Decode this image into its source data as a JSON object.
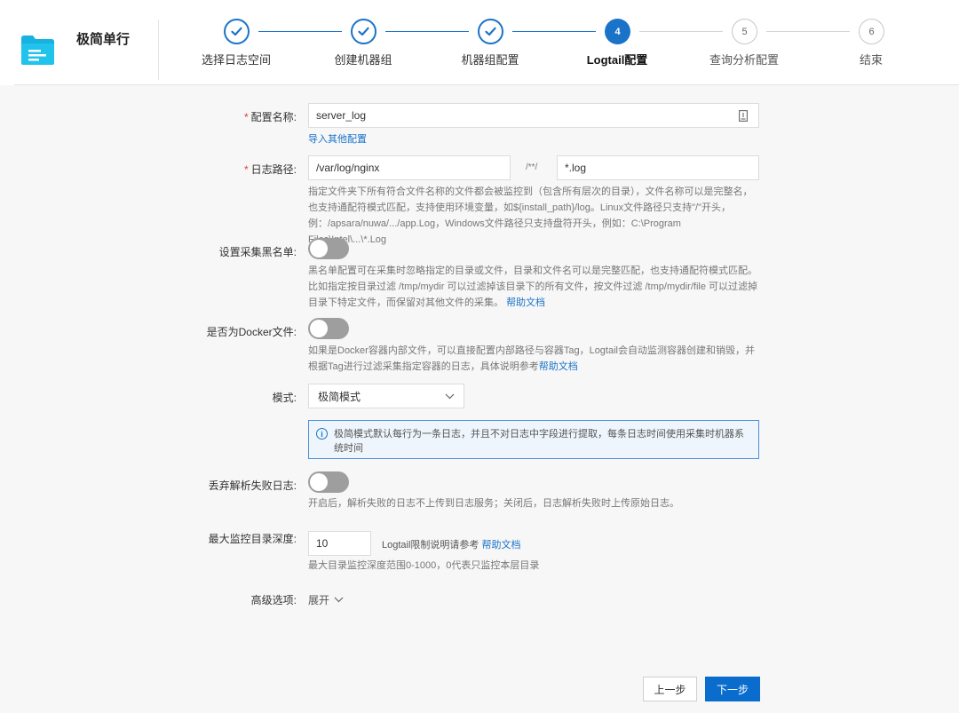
{
  "app": {
    "title": "极简单行"
  },
  "steps": [
    {
      "label": "选择日志空间",
      "state": "done"
    },
    {
      "label": "创建机器组",
      "state": "done"
    },
    {
      "label": "机器组配置",
      "state": "done"
    },
    {
      "label": "Logtail配置",
      "number": "4",
      "state": "active"
    },
    {
      "label": "查询分析配置",
      "number": "5",
      "state": "todo"
    },
    {
      "label": "结束",
      "number": "6",
      "state": "todo"
    }
  ],
  "form": {
    "required_mark": "*",
    "config_name": {
      "label": "配置名称:",
      "value": "server_log",
      "import_link": "导入其他配置"
    },
    "log_path": {
      "label": "日志路径:",
      "dir_value": "/var/log/nginx",
      "separator": "/**/",
      "file_value": "*.log",
      "help": "指定文件夹下所有符合文件名称的文件都会被监控到（包含所有层次的目录），文件名称可以是完整名，也支持通配符模式匹配，支持使用环境变量，如${install_path}/log。Linux文件路径只支持\"/\"开头，例：/apsara/nuwa/.../app.Log，Windows文件路径只支持盘符开头，例如：C:\\Program Files\\Intel\\...\\*.Log"
    },
    "blacklist": {
      "label": "设置采集黑名单:",
      "enabled": false,
      "help": "黑名单配置可在采集时忽略指定的目录或文件，目录和文件名可以是完整匹配，也支持通配符模式匹配。比如指定按目录过滤 /tmp/mydir 可以过滤掉该目录下的所有文件，按文件过滤 /tmp/mydir/file 可以过滤掉目录下特定文件，而保留对其他文件的采集。",
      "help_link": "帮助文档"
    },
    "docker": {
      "label": "是否为Docker文件:",
      "enabled": false,
      "help": "如果是Docker容器内部文件，可以直接配置内部路径与容器Tag，Logtail会自动监测容器创建和销毁，并根据Tag进行过滤采集指定容器的日志，具体说明参考",
      "help_link": "帮助文档"
    },
    "mode": {
      "label": "模式:",
      "selected": "极简模式",
      "info": "极简模式默认每行为一条日志，并且不对日志中字段进行提取，每条日志时间使用采集时机器系统时间"
    },
    "discard_failed": {
      "label": "丢弃解析失败日志:",
      "enabled": false,
      "help": "开启后，解析失败的日志不上传到日志服务；关闭后，日志解析失败时上传原始日志。"
    },
    "max_depth": {
      "label": "最大监控目录深度:",
      "value": "10",
      "note": "Logtail限制说明请参考",
      "note_link": "帮助文档",
      "help": "最大目录监控深度范围0-1000，0代表只监控本层目录"
    },
    "advanced": {
      "label": "高级选项:",
      "toggle_text": "展开"
    }
  },
  "footer": {
    "prev_label": "上一步",
    "next_label": "下一步"
  },
  "colors": {
    "primary": "#1a73c9",
    "toggle_off": "#9e9e9e",
    "required": "#e4393c"
  }
}
